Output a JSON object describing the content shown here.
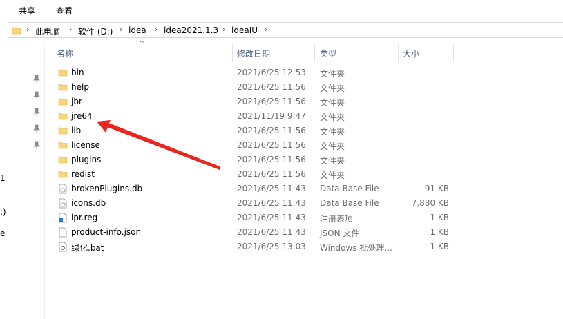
{
  "ribbon": {
    "tabs": [
      "共享",
      "查看"
    ]
  },
  "address": {
    "path": [
      "此电脑",
      "软件 (D:)",
      "idea",
      "idea2021.1.3",
      "ideaIU"
    ]
  },
  "nav": {
    "fragments": [
      "1",
      ":)",
      "e"
    ]
  },
  "columns": {
    "name": "名称",
    "date": "修改日期",
    "type": "类型",
    "size": "大小"
  },
  "files": [
    {
      "name": "bin",
      "date": "2021/6/25 12:53",
      "type": "文件夹",
      "size": "",
      "icon": "folder-icon"
    },
    {
      "name": "help",
      "date": "2021/6/25 11:56",
      "type": "文件夹",
      "size": "",
      "icon": "folder-icon"
    },
    {
      "name": "jbr",
      "date": "2021/6/25 11:56",
      "type": "文件夹",
      "size": "",
      "icon": "folder-icon"
    },
    {
      "name": "jre64",
      "date": "2021/11/19 9:47",
      "type": "文件夹",
      "size": "",
      "icon": "folder-icon"
    },
    {
      "name": "lib",
      "date": "2021/6/25 11:56",
      "type": "文件夹",
      "size": "",
      "icon": "folder-icon"
    },
    {
      "name": "license",
      "date": "2021/6/25 11:56",
      "type": "文件夹",
      "size": "",
      "icon": "folder-icon"
    },
    {
      "name": "plugins",
      "date": "2021/6/25 11:56",
      "type": "文件夹",
      "size": "",
      "icon": "folder-icon"
    },
    {
      "name": "redist",
      "date": "2021/6/25 11:56",
      "type": "文件夹",
      "size": "",
      "icon": "folder-icon"
    },
    {
      "name": "brokenPlugins.db",
      "date": "2021/6/25 11:43",
      "type": "Data Base File",
      "size": "91 KB",
      "icon": "database-file-icon"
    },
    {
      "name": "icons.db",
      "date": "2021/6/25 11:43",
      "type": "Data Base File",
      "size": "7,880 KB",
      "icon": "database-file-icon"
    },
    {
      "name": "ipr.reg",
      "date": "2021/6/25 11:43",
      "type": "注册表项",
      "size": "1 KB",
      "icon": "registry-file-icon"
    },
    {
      "name": "product-info.json",
      "date": "2021/6/25 11:43",
      "type": "JSON 文件",
      "size": "1 KB",
      "icon": "blank-file-icon"
    },
    {
      "name": "绿化.bat",
      "date": "2021/6/25 13:03",
      "type": "Windows 批处理...",
      "size": "1 KB",
      "icon": "batch-file-icon"
    }
  ],
  "colors": {
    "folder": "#f8d775",
    "header_text": "#4d6082",
    "arrow": "#e8261e"
  }
}
